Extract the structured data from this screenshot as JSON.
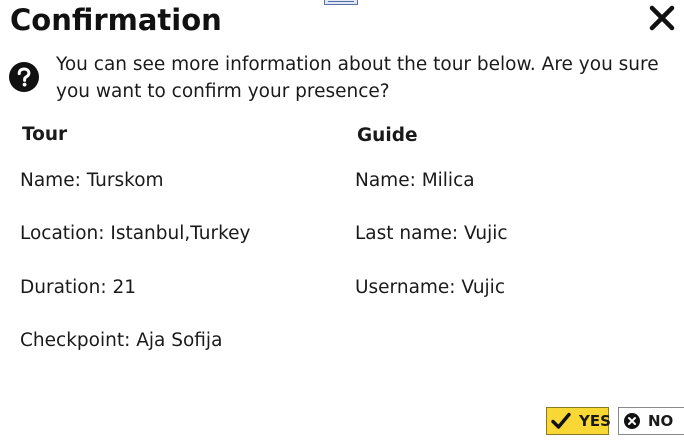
{
  "dialog": {
    "title": "Confirmation",
    "message": "You can see more information about the tour below. Are you sure you want to confirm your presence?"
  },
  "tour": {
    "header": "Tour",
    "name": "Name: Turskom",
    "location": "Location: Istanbul,Turkey",
    "duration": "Duration: 21",
    "checkpoint": "Checkpoint: Aja Sofija"
  },
  "guide": {
    "header": "Guide",
    "name": "Name: Milica",
    "last_name": "Last name: Vujic",
    "username": "Username: Vujic"
  },
  "buttons": {
    "yes_label": "YES",
    "no_label": "NO"
  },
  "icons": {
    "close": "close-icon",
    "help": "question-circle-icon",
    "check": "checkmark-icon",
    "cancel": "x-circle-icon"
  },
  "colors": {
    "yes_button": "#f9d835"
  }
}
